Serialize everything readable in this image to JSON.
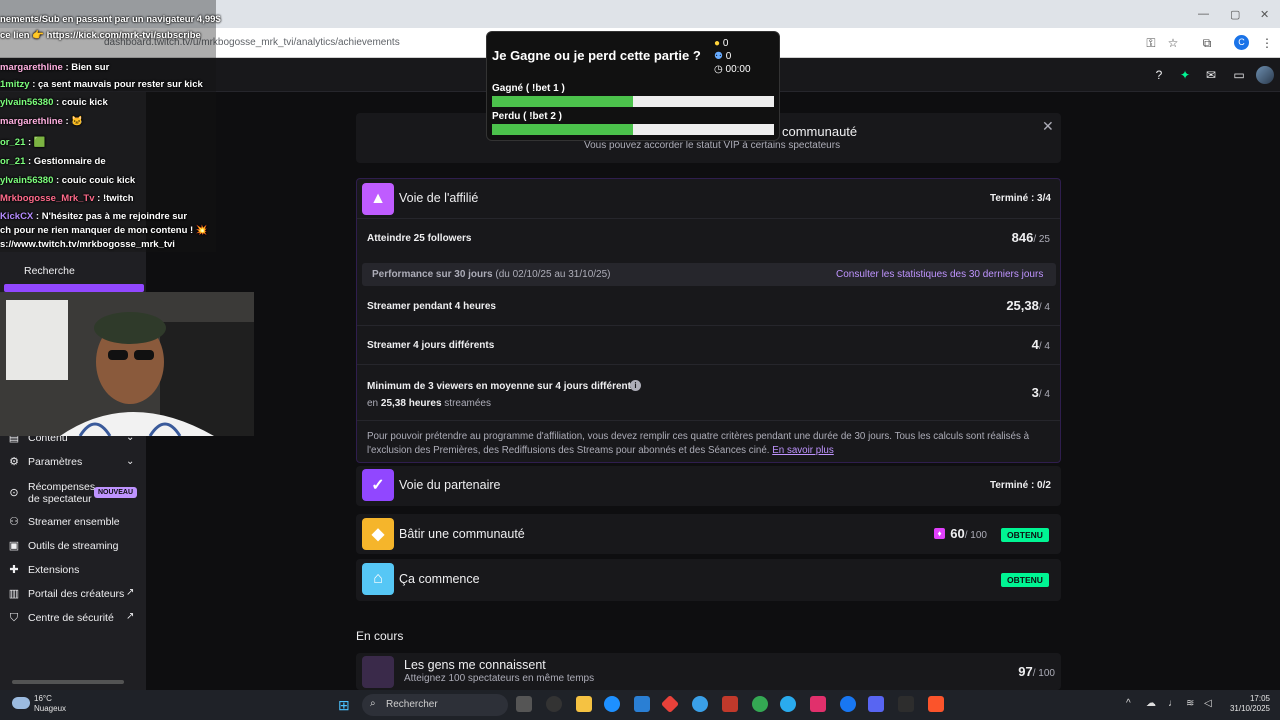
{
  "browser": {
    "url": "dashboard.twitch.tv/u/mrkbogosse_mrk_tvi/analytics/achievements",
    "profile_initial": "C"
  },
  "sidebar": {
    "items": [
      {
        "label": "Recherche"
      },
      {
        "label": "Contenu"
      },
      {
        "label": "Paramètres"
      },
      {
        "label": "Récompenses de spectateur",
        "badge": "NOUVEAU"
      },
      {
        "label": "Streamer ensemble"
      },
      {
        "label": "Outils de streaming"
      },
      {
        "label": "Extensions"
      },
      {
        "label": "Portail des créateurs"
      },
      {
        "label": "Centre de sécurité"
      }
    ]
  },
  "vip_banner": {
    "title": "communauté",
    "subtitle": "Vous pouvez accorder le statut VIP à certains spectateurs"
  },
  "affiliate": {
    "title": "Voie de l'affilié",
    "status": "Terminé : 3/4",
    "followers_label": "Atteindre 25 followers",
    "followers_value": "846",
    "followers_goal": "/ 25",
    "perf_title": "Performance sur 30 jours",
    "perf_range": "(du 02/10/25 au 31/10/25)",
    "perf_link": "Consulter les statistiques des 30 derniers jours",
    "hours_label": "Streamer pendant 4 heures",
    "hours_value": "25,38",
    "hours_goal": "/ 4",
    "days_label": "Streamer 4 jours différents",
    "days_value": "4",
    "days_goal": "/ 4",
    "viewers_label": "Minimum de 3 viewers en moyenne sur 4 jours différents",
    "viewers_sub_prefix": "en",
    "viewers_sub_bold": "25,38 heures",
    "viewers_sub_suffix": "streamées",
    "viewers_value": "3",
    "viewers_goal": "/ 4",
    "note": "Pour pouvoir prétendre au programme d'affiliation, vous devez remplir ces quatre critères pendant une durée de 30 jours. Tous les calculs sont réalisés à l'exclusion des Premières, des Rediffusions des Streams pour abonnés et des Séances ciné.",
    "note_link": "En savoir plus"
  },
  "partner": {
    "title": "Voie du partenaire",
    "status": "Terminé : 0/2"
  },
  "community": {
    "title": "Bâtir une communauté",
    "value": "60",
    "goal": "/ 100",
    "badge": "OBTENU"
  },
  "start": {
    "title": "Ça commence",
    "badge": "OBTENU"
  },
  "in_progress": {
    "heading": "En cours",
    "title": "Les gens me connaissent",
    "subtitle": "Atteignez 100 spectateurs en même temps",
    "value": "97",
    "goal": "/ 100"
  },
  "bet": {
    "question": "Je Gagne ou je perd cette partie ?",
    "coins": "0",
    "users": "0",
    "timer": "00:00",
    "option1": "Gagné ( !bet 1 )",
    "option1_fill": 0.5,
    "option2": "Perdu ( !bet 2 )",
    "option2_fill": 0.5
  },
  "chat": [
    {
      "user": "",
      "text": "nements/Sub en passant par un navigateur 4,99$"
    },
    {
      "user": "",
      "text": "ce lien 👉 https://kick.com/mrk-tvi/subscribe"
    },
    {
      "user": "margarethline",
      "text": " : Bien sur"
    },
    {
      "user": "1mitzy",
      "text": " : ça sent mauvais pour rester sur kick"
    },
    {
      "user": "ylvain56380",
      "text": " : couic kick"
    },
    {
      "user": "margarethline",
      "text": " : 🐱"
    },
    {
      "user": "or_21",
      "text": " : 🟩"
    },
    {
      "user": "or_21",
      "text": " : Gestionnaire de"
    },
    {
      "user": "ylvain56380",
      "text": " : couic couic kick"
    },
    {
      "user": "Mrkbogosse_Mrk_Tv",
      "text": " : !twitch"
    },
    {
      "user": "KickCX",
      "text": " : N'hésitez pas à me rejoindre sur"
    },
    {
      "user": "",
      "text": "ch pour ne rien manquer de mon contenu ! 💥"
    },
    {
      "user": "",
      "text": "s://www.twitch.tv/mrkbogosse_mrk_tvi"
    }
  ],
  "taskbar": {
    "temp": "16°C",
    "weather": "Nuageux",
    "search": "Rechercher",
    "time": "17:05",
    "date": "31/10/2025"
  },
  "colors": {
    "affiliate_icon": "#bf5cff",
    "partner_icon": "#9147ff",
    "community_icon": "#f5b52b",
    "start_icon": "#56c7f5",
    "obtained": "#00f593",
    "link": "#bf94ff"
  }
}
